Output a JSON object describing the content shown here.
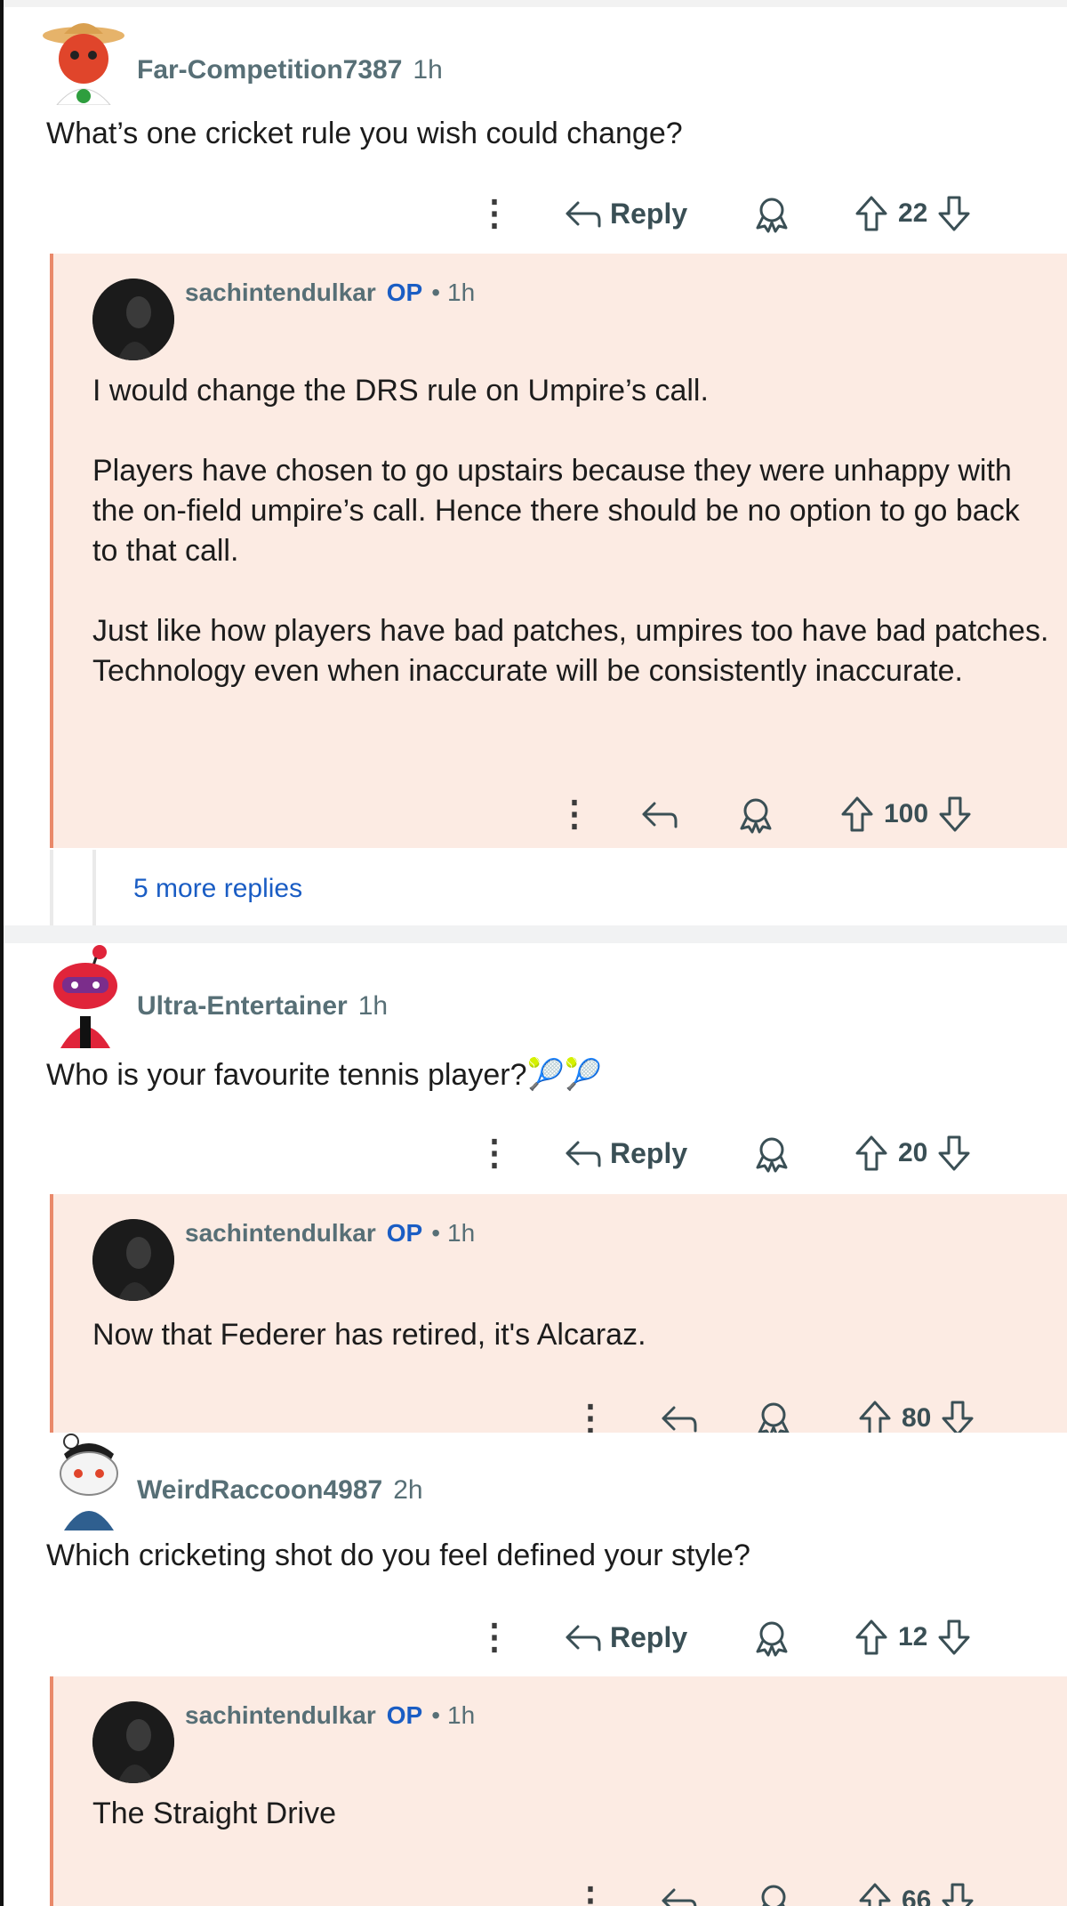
{
  "comments": [
    {
      "author": "Far-Competition7387",
      "time": "1h",
      "text": "What’s one cricket rule you wish could change?",
      "reply_label": "Reply",
      "score": "22",
      "reply": {
        "author": "sachintendulkar",
        "op": "OP",
        "sep": "•",
        "time": "1h",
        "paragraphs": [
          "I would change the DRS rule on Umpire’s call.",
          "Players have chosen to go upstairs because they were unhappy with the on-field umpire’s call. Hence there should be no option to go back to that call.",
          "Just like how players have bad patches, umpires too have bad patches. Technology even when inaccurate will be consistently inaccurate."
        ],
        "score": "100"
      },
      "more_replies": "5 more replies"
    },
    {
      "author": "Ultra-Entertainer",
      "time": "1h",
      "text": "Who is your favourite tennis player?🎾🎾",
      "reply_label": "Reply",
      "score": "20",
      "reply": {
        "author": "sachintendulkar",
        "op": "OP",
        "sep": "•",
        "time": "1h",
        "paragraphs": [
          "Now that Federer has retired, it's Alcaraz."
        ],
        "score": "80"
      }
    },
    {
      "author": "WeirdRaccoon4987",
      "time": "2h",
      "text": "Which cricketing shot do you feel defined your style?",
      "reply_label": "Reply",
      "score": "12",
      "reply": {
        "author": "sachintendulkar",
        "op": "OP",
        "sep": "•",
        "time": "1h",
        "paragraphs": [
          "The Straight Drive"
        ],
        "score": "66"
      }
    }
  ],
  "colors": {
    "reply_bg": "#fcebe3",
    "reply_border": "#e9896a",
    "op_blue": "#1a5dc4",
    "meta_gray": "#576f76"
  }
}
